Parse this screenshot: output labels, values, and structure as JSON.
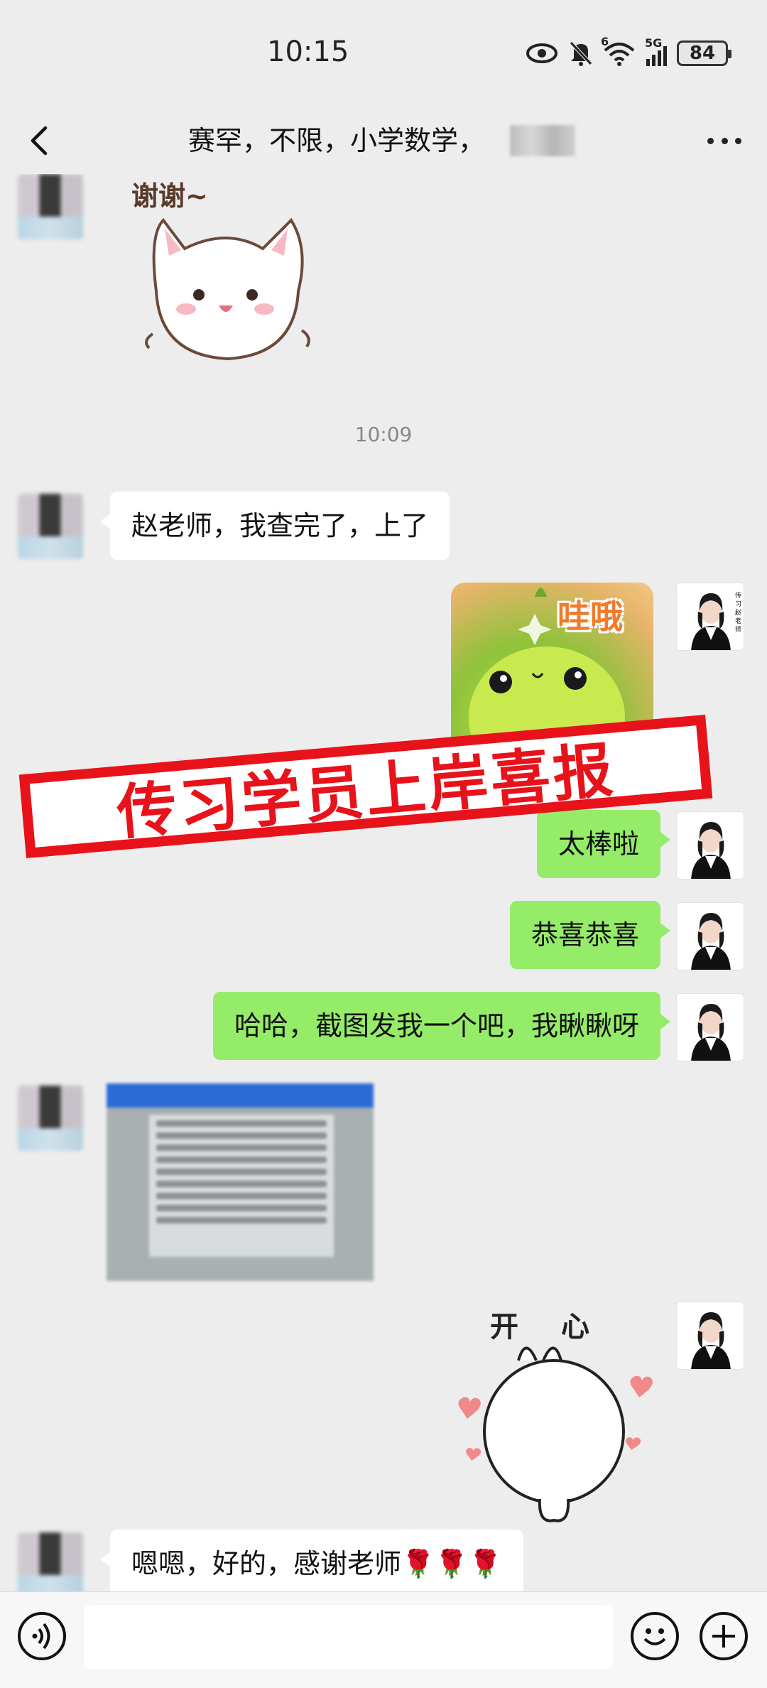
{
  "status_bar": {
    "time": "10:15",
    "battery": "84",
    "network": "5G",
    "wifi_badge": "6"
  },
  "header": {
    "title": "赛罕，不限，小学数学，"
  },
  "messages": {
    "sticker1_text": "谢谢~",
    "timestamp": "10:09",
    "msg1": "赵老师，我查完了，上了",
    "sticker2_text": "哇哦",
    "msg2": "太棒啦",
    "msg3": "恭喜恭喜",
    "msg4": "哈哈，截图发我一个吧，我瞅瞅呀",
    "sticker3_text": "开心",
    "msg5": "嗯嗯，好的，感谢老师🌹🌹🌹"
  },
  "teacher_avatar_label": "传习赵老师",
  "banner": {
    "text": "传习学员上岸喜报"
  },
  "input": {
    "placeholder": ""
  }
}
